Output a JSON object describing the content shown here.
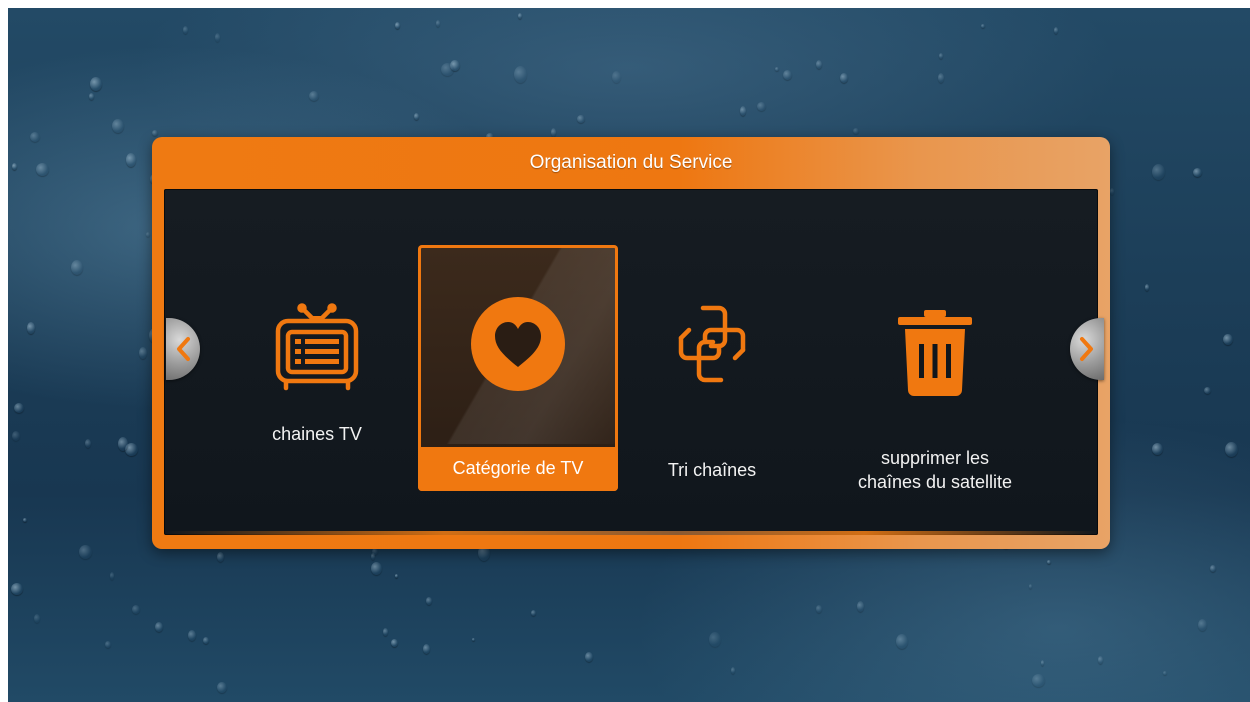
{
  "dialog": {
    "title": "Organisation du Service"
  },
  "menu": {
    "items": [
      {
        "label": "chaines TV",
        "icon": "tv-list-icon",
        "selected": false
      },
      {
        "label": "Catégorie de TV",
        "icon": "heart-icon",
        "selected": true
      },
      {
        "label": "Tri chaînes",
        "icon": "interlink-icon",
        "selected": false
      },
      {
        "label_line1": "supprimer les",
        "label_line2": "chaînes du satellite",
        "icon": "trash-icon",
        "selected": false
      }
    ]
  },
  "navigation": {
    "left_icon": "chevron-left-icon",
    "right_icon": "chevron-right-icon"
  },
  "colors": {
    "accent": "#f07810",
    "panel": "#10161c",
    "icon": "#f07810"
  }
}
